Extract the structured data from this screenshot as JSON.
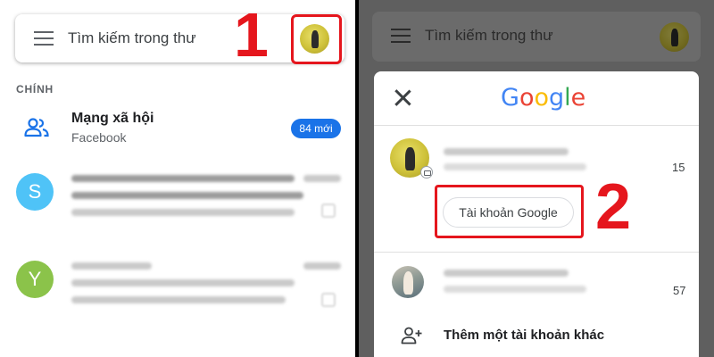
{
  "left_screen": {
    "search": {
      "placeholder": "Tìm kiếm trong thư"
    },
    "step_label": "1",
    "section_label": "CHÍNH",
    "social": {
      "title": "Mạng xã hội",
      "subtitle": "Facebook",
      "badge": "84 mới"
    },
    "mails": [
      {
        "avatar_letter": "S",
        "avatar_color": "#4fc3f7"
      },
      {
        "avatar_letter": "Y",
        "avatar_color": "#8bc34a"
      }
    ]
  },
  "right_screen": {
    "search": {
      "placeholder": "Tìm kiếm trong thư"
    },
    "close_icon": "close-icon",
    "logo": {
      "letters": [
        "G",
        "o",
        "o",
        "g",
        "l",
        "e"
      ],
      "colors": [
        "#4285f4",
        "#ea4335",
        "#fbbc05",
        "#4285f4",
        "#34a853",
        "#ea4335"
      ]
    },
    "primary_account": {
      "count": "15"
    },
    "account_button": "Tài khoản Google",
    "step_label": "2",
    "secondary_account": {
      "count": "57"
    },
    "add_account": "Thêm một tài khoản khác"
  },
  "colors": {
    "highlight_red": "#e5161d",
    "accent_blue": "#1a73e8"
  }
}
